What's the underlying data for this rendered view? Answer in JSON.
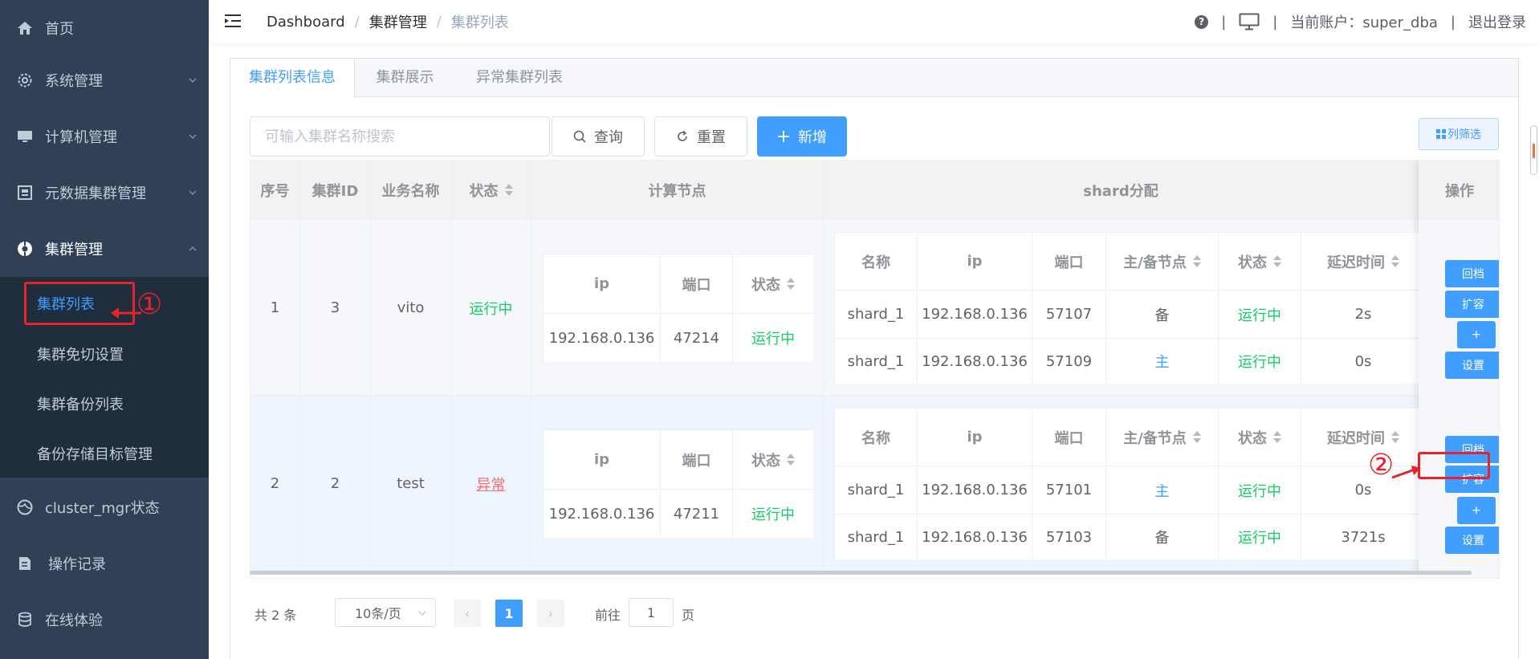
{
  "sidebar": {
    "items": [
      {
        "label": "首页",
        "icon": "home-icon"
      },
      {
        "label": "系统管理",
        "icon": "gear-icon"
      },
      {
        "label": "计算机管理",
        "icon": "monitor-icon"
      },
      {
        "label": "元数据集群管理",
        "icon": "database-icon"
      },
      {
        "label": "集群管理",
        "icon": "cluster-icon"
      },
      {
        "label": "cluster_mgr状态",
        "icon": "globe-icon"
      },
      {
        "label": "操作记录",
        "icon": "document-icon"
      },
      {
        "label": "在线体验",
        "icon": "storage-icon"
      }
    ],
    "submenu": [
      "集群列表",
      "集群免切设置",
      "集群备份列表",
      "备份存储目标管理"
    ],
    "active_sub": "集群列表"
  },
  "annotations": {
    "one": "①",
    "two": "②"
  },
  "navbar": {
    "breadcrumb": [
      "Dashboard",
      "集群管理",
      "集群列表"
    ],
    "separator": "/",
    "help": "?",
    "account_label": "当前账户：super_dba",
    "logout": "退出登录",
    "divider": "|"
  },
  "tabs": [
    "集群列表信息",
    "集群展示",
    "异常集群列表"
  ],
  "toolbar": {
    "search_placeholder": "可输入集群名称搜索",
    "query": "查询",
    "reset": "重置",
    "add": "新增",
    "column_filter": "列筛选"
  },
  "table": {
    "headers": {
      "index": "序号",
      "cluster_id": "集群ID",
      "business": "业务名称",
      "status": "状态",
      "compute": "计算节点",
      "shard": "shard分配",
      "ops": "操作"
    },
    "compute_headers": {
      "ip": "ip",
      "port": "端口",
      "status": "状态"
    },
    "shard_headers": {
      "name": "名称",
      "ip": "ip",
      "port": "端口",
      "role": "主/备节点",
      "status": "状态",
      "delay": "延迟时间"
    },
    "rows": [
      {
        "index": "1",
        "cluster_id": "3",
        "business": "vito",
        "status": "运行中",
        "status_type": "ok",
        "compute": {
          "ip": "192.168.0.136",
          "port": "47214",
          "status": "运行中"
        },
        "shards": [
          {
            "name": "shard_1",
            "ip": "192.168.0.136",
            "port": "57107",
            "role": "备",
            "role_type": "standby",
            "status": "运行中",
            "delay": "2s"
          },
          {
            "name": "shard_1",
            "ip": "192.168.0.136",
            "port": "57109",
            "role": "主",
            "role_type": "primary",
            "status": "运行中",
            "delay": "0s"
          }
        ]
      },
      {
        "index": "2",
        "cluster_id": "2",
        "business": "test",
        "status": "异常",
        "status_type": "error",
        "compute": {
          "ip": "192.168.0.136",
          "port": "47211",
          "status": "运行中"
        },
        "shards": [
          {
            "name": "shard_1",
            "ip": "192.168.0.136",
            "port": "57101",
            "role": "主",
            "role_type": "primary",
            "status": "运行中",
            "delay": "0s"
          },
          {
            "name": "shard_1",
            "ip": "192.168.0.136",
            "port": "57103",
            "role": "备",
            "role_type": "standby",
            "status": "运行中",
            "delay": "3721s"
          }
        ]
      }
    ],
    "op_buttons": {
      "rollback": "回档",
      "expand": "扩容",
      "plus": "+",
      "settings": "设置"
    }
  },
  "pagination": {
    "total": "共 2 条",
    "page_size": "10条/页",
    "prev": "‹",
    "current": "1",
    "next": "›",
    "goto_label": "前往",
    "goto_value": "1",
    "page_unit": "页"
  },
  "colors": {
    "sidebar_bg": "#304156",
    "submenu_bg": "#1f2d3d",
    "primary": "#409eff",
    "success": "#13ce66",
    "danger": "#f56c6c",
    "annotation": "#e8212b"
  }
}
